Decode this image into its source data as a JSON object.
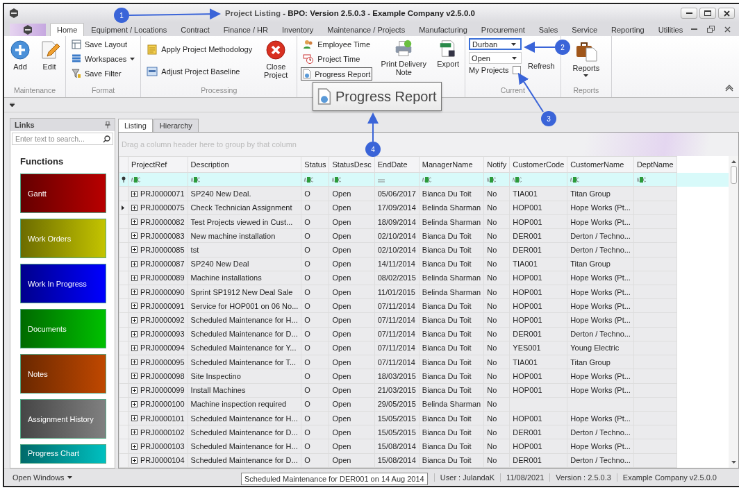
{
  "window": {
    "title_document": "Project Listing",
    "title_rest": "- BPO: Version 2.5.0.3 - Example Company v2.5.0.0"
  },
  "ribbon_tabs": [
    {
      "label": "Home",
      "selected": true
    },
    {
      "label": "Equipment / Locations",
      "selected": false
    },
    {
      "label": "Contract",
      "selected": false
    },
    {
      "label": "Finance / HR",
      "selected": false
    },
    {
      "label": "Inventory",
      "selected": false
    },
    {
      "label": "Maintenance / Projects",
      "selected": false
    },
    {
      "label": "Manufacturing",
      "selected": false
    },
    {
      "label": "Procurement",
      "selected": false
    },
    {
      "label": "Sales",
      "selected": false
    },
    {
      "label": "Service",
      "selected": false
    },
    {
      "label": "Reporting",
      "selected": false
    },
    {
      "label": "Utilities",
      "selected": false
    }
  ],
  "ribbon": {
    "maintenance_group": {
      "label": "Maintenance",
      "add_button": "Add",
      "edit_button": "Edit"
    },
    "format_group": {
      "label": "Format",
      "save_layout": "Save Layout",
      "workspaces": "Workspaces",
      "save_filter": "Save Filter"
    },
    "processing_group": {
      "label": "Processing",
      "apply_methodology": "Apply Project Methodology",
      "adjust_baseline": "Adjust Project Baseline",
      "close_project": "Close Project"
    },
    "time_group": {
      "employee_time": "Employee Time",
      "project_time": "Project Time",
      "progress_report": {
        "label": "Progress Report",
        "highlighted": true
      },
      "print_delivery_note": "Print Delivery Note",
      "export": "Export"
    },
    "current_group": {
      "label": "Current",
      "branch_dropdown": {
        "value": "Durban",
        "highlighted": true
      },
      "status_dropdown": {
        "value": "Open",
        "highlighted": false
      },
      "my_projects": {
        "label": "My Projects",
        "checked": false
      },
      "refresh": "Refresh"
    },
    "reports_group": {
      "label": "Reports",
      "reports_button": "Reports"
    }
  },
  "callouts": [
    {
      "number": "1"
    },
    {
      "number": "2"
    },
    {
      "number": "3"
    },
    {
      "number": "4"
    }
  ],
  "magnifier": {
    "label": "Progress Report"
  },
  "links_panel": {
    "title": "Links",
    "search": {
      "placeholder": "Enter text to search..."
    },
    "heading": "Functions",
    "tiles": [
      {
        "label": "Gantt",
        "color": "#b80000"
      },
      {
        "label": "Work Orders",
        "color": "#c4c400"
      },
      {
        "label": "Work In Progress",
        "color": "#0000ff"
      },
      {
        "label": "Documents",
        "color": "#00c000"
      },
      {
        "label": "Notes",
        "color": "#c04800"
      },
      {
        "label": "Assignment History",
        "color": "#808080"
      },
      {
        "label": "Progress Chart",
        "color": "#00c0c0"
      }
    ]
  },
  "view_tabs": [
    {
      "label": "Listing",
      "selected": true
    },
    {
      "label": "Hierarchy",
      "selected": false
    }
  ],
  "grid": {
    "group_panel": "Drag a column header here to group by that column",
    "columns": [
      "ProjectRef",
      "Description",
      "Status",
      "StatusDesc",
      "EndDate",
      "ManagerName",
      "Notify",
      "CustomerCode",
      "CustomerName",
      "DeptName"
    ],
    "filters": [
      {
        "kind": "text"
      },
      {
        "kind": "text"
      },
      {
        "kind": "text"
      },
      {
        "kind": "text"
      },
      {
        "kind": "equals"
      },
      {
        "kind": "text"
      },
      {
        "kind": "text"
      },
      {
        "kind": "text"
      },
      {
        "kind": "text"
      },
      {
        "kind": "text"
      }
    ],
    "rows": [
      {
        "current": false,
        "cells": [
          "PRJ0000071",
          "SP240 New Deal.",
          "O",
          "Open",
          "05/06/2017",
          "Bianca Du Toit",
          "No",
          "TIA001",
          "Titan Group",
          ""
        ]
      },
      {
        "current": true,
        "cells": [
          "PRJ0000075",
          "Check Technician Assignment",
          "O",
          "Open",
          "17/09/2014",
          "Belinda Sharman",
          "No",
          "HOP001",
          "Hope Works (Pt...",
          ""
        ]
      },
      {
        "current": false,
        "cells": [
          "PRJ0000082",
          "Test Projects viewed in Cust...",
          "O",
          "Open",
          "18/09/2014",
          "Belinda Sharman",
          "No",
          "HOP001",
          "Hope Works (Pt...",
          ""
        ]
      },
      {
        "current": false,
        "cells": [
          "PRJ0000083",
          "New machine installation",
          "O",
          "Open",
          "02/10/2014",
          "Bianca Du Toit",
          "No",
          "DER001",
          "Derton / Techno...",
          ""
        ]
      },
      {
        "current": false,
        "cells": [
          "PRJ0000085",
          "tst",
          "O",
          "Open",
          "02/10/2014",
          "Bianca Du Toit",
          "No",
          "DER001",
          "Derton / Techno...",
          ""
        ]
      },
      {
        "current": false,
        "cells": [
          "PRJ0000087",
          "SP240 New Deal",
          "O",
          "Open",
          "14/11/2014",
          "Bianca Du Toit",
          "No",
          "TIA001",
          "Titan Group",
          ""
        ]
      },
      {
        "current": false,
        "cells": [
          "PRJ0000089",
          "Machine installations",
          "O",
          "Open",
          "08/02/2015",
          "Belinda Sharman",
          "No",
          "HOP001",
          "Hope Works (Pt...",
          ""
        ]
      },
      {
        "current": false,
        "cells": [
          "PRJ0000090",
          "Sprint SP1912 New Deal Sale",
          "O",
          "Open",
          "11/01/2015",
          "Belinda Sharman",
          "No",
          "HOP001",
          "Hope Works (Pt...",
          ""
        ]
      },
      {
        "current": false,
        "cells": [
          "PRJ0000091",
          "Service for HOP001 on 06 No...",
          "O",
          "Open",
          "07/11/2014",
          "Bianca Du Toit",
          "No",
          "HOP001",
          "Hope Works (Pt...",
          ""
        ]
      },
      {
        "current": false,
        "cells": [
          "PRJ0000092",
          "Scheduled Maintenance for H...",
          "O",
          "Open",
          "07/11/2014",
          "Bianca Du Toit",
          "No",
          "HOP001",
          "Hope Works (Pt...",
          ""
        ]
      },
      {
        "current": false,
        "cells": [
          "PRJ0000093",
          "Scheduled Maintenance for D...",
          "O",
          "Open",
          "07/11/2014",
          "Bianca Du Toit",
          "No",
          "DER001",
          "Derton / Techno...",
          ""
        ]
      },
      {
        "current": false,
        "cells": [
          "PRJ0000094",
          "Scheduled Maintenance for Y...",
          "O",
          "Open",
          "07/11/2014",
          "Bianca Du Toit",
          "No",
          "YES001",
          "Young Electric",
          ""
        ]
      },
      {
        "current": false,
        "cells": [
          "PRJ0000095",
          "Scheduled Maintenance for T...",
          "O",
          "Open",
          "07/11/2014",
          "Bianca Du Toit",
          "No",
          "TIA001",
          "Titan Group",
          ""
        ]
      },
      {
        "current": false,
        "cells": [
          "PRJ0000098",
          "Site Inspectino",
          "O",
          "Open",
          "18/03/2015",
          "Bianca Du Toit",
          "No",
          "HOP001",
          "Hope Works (Pt...",
          ""
        ]
      },
      {
        "current": false,
        "cells": [
          "PRJ0000099",
          "Install Machines",
          "O",
          "Open",
          "21/03/2015",
          "Bianca Du Toit",
          "No",
          "HOP001",
          "Hope Works (Pt...",
          ""
        ]
      },
      {
        "current": false,
        "cells": [
          "PRJ0000100",
          "Machine inspection required",
          "O",
          "Open",
          "29/05/2015",
          "Belinda Sharman",
          "No",
          "",
          "",
          ""
        ]
      },
      {
        "current": false,
        "cells": [
          "PRJ0000101",
          "Scheduled Maintenance for H...",
          "O",
          "Open",
          "15/05/2015",
          "Bianca Du Toit",
          "No",
          "HOP001",
          "Hope Works (Pt...",
          ""
        ]
      },
      {
        "current": false,
        "cells": [
          "PRJ0000102",
          "Scheduled Maintenance for D...",
          "O",
          "Open",
          "15/05/2015",
          "Bianca Du Toit",
          "No",
          "DER001",
          "Derton / Techno...",
          ""
        ]
      },
      {
        "current": false,
        "cells": [
          "PRJ0000103",
          "Scheduled Maintenance for H...",
          "O",
          "Open",
          "15/08/2014",
          "Bianca Du Toit",
          "No",
          "HOP001",
          "Hope Works (Pt...",
          ""
        ]
      },
      {
        "current": false,
        "cells": [
          "PRJ0000104",
          "Scheduled Maintenance for D...",
          "O",
          "Open",
          "15/08/2014",
          "Bianca Du Toit",
          "No",
          "DER001",
          "Derton / Techno...",
          ""
        ]
      }
    ]
  },
  "status_bar": {
    "open_windows": "Open Windows",
    "tooltip": "Scheduled Maintenance for DER001 on 14 Aug 2014",
    "fields": [
      "User : JulandaK",
      "11/08/2021",
      "Version : 2.5.0.3",
      "Example Company v2.5.0.0"
    ]
  }
}
